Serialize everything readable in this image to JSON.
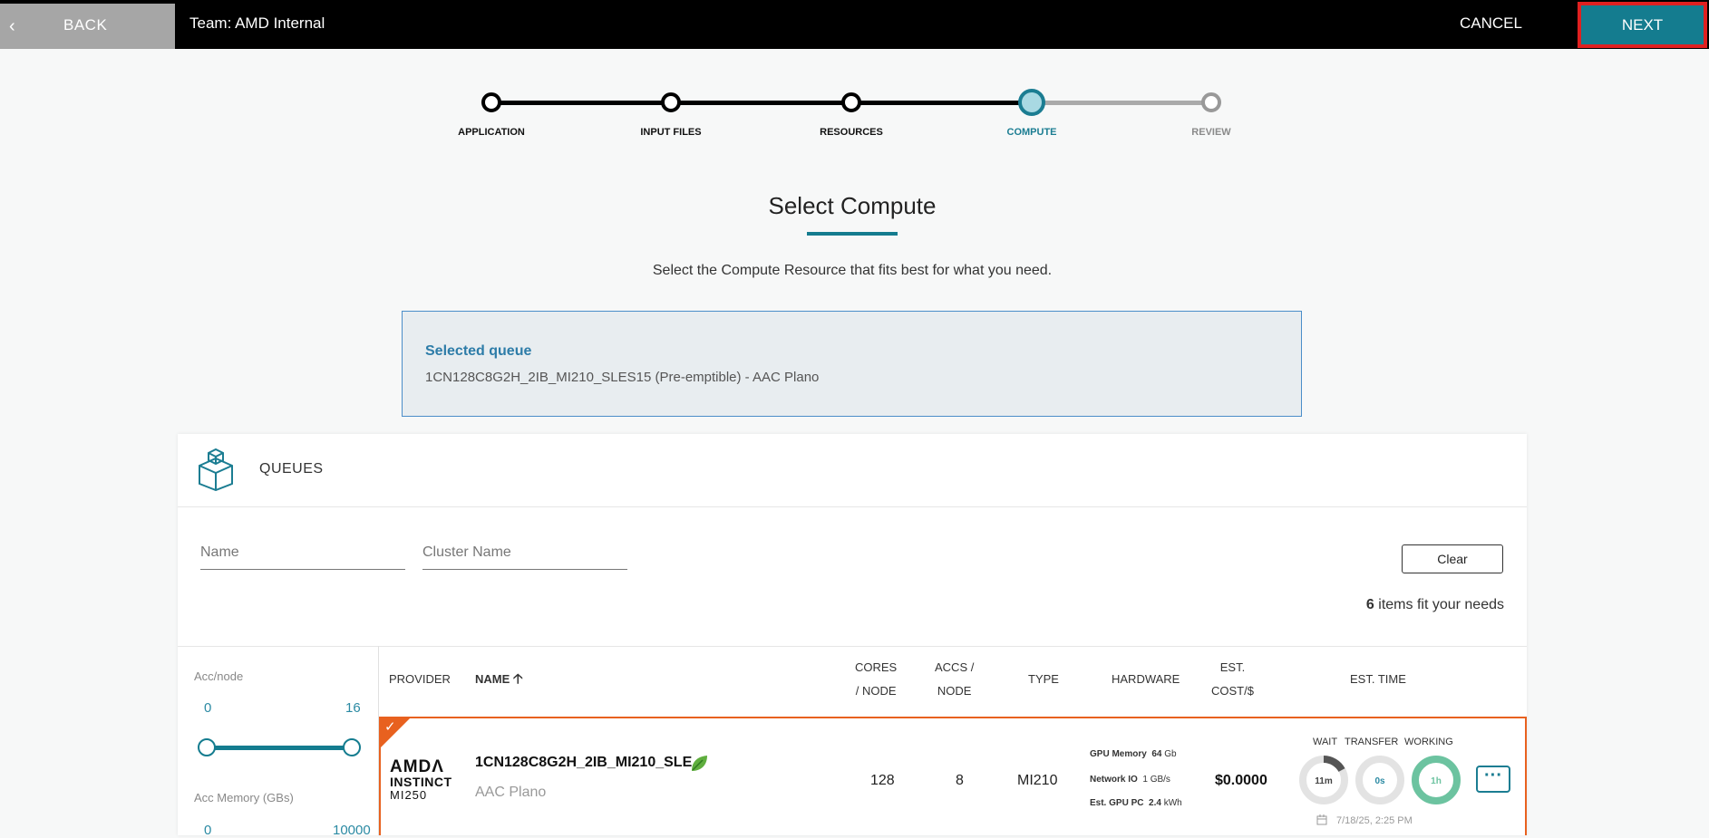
{
  "topbar": {
    "back_icon": "chevron-left-icon",
    "back_label": "BACK",
    "team": "Team: AMD Internal",
    "cancel_label": "CANCEL",
    "next_label": "NEXT"
  },
  "steps": [
    {
      "label": "APPLICATION",
      "state": "done"
    },
    {
      "label": "INPUT FILES",
      "state": "done"
    },
    {
      "label": "RESOURCES",
      "state": "done"
    },
    {
      "label": "COMPUTE",
      "state": "current"
    },
    {
      "label": "REVIEW",
      "state": "future"
    }
  ],
  "page": {
    "title": "Select Compute",
    "subtitle": "Select the Compute Resource that fits best for what you need."
  },
  "selected_queue": {
    "heading": "Selected queue",
    "value": "1CN128C8G2H_2IB_MI210_SLES15 (Pre-emptible) - AAC Plano"
  },
  "queues": {
    "title": "QUEUES",
    "icon": "cube-icon",
    "filters": {
      "name_placeholder": "Name",
      "cluster_placeholder": "Cluster Name"
    },
    "clear_label": "Clear",
    "count": "6",
    "count_suffix": " items fit your needs",
    "side_filters": {
      "acc_node_label": "Acc/node",
      "acc_node_min": "0",
      "acc_node_max": "16",
      "acc_memory_label": "Acc Memory (GBs)",
      "acc_memory_min": "0",
      "acc_memory_max": "10000"
    },
    "columns": {
      "provider": "PROVIDER",
      "name": "NAME",
      "cores_1": "CORES",
      "cores_2": "/ NODE",
      "accs_1": "ACCS /",
      "accs_2": "NODE",
      "type": "TYPE",
      "hardware": "HARDWARE",
      "cost_1": "EST.",
      "cost_2": "COST/$",
      "time": "EST. TIME"
    },
    "row": {
      "logo_line1": "AMDΛ",
      "logo_line2": "INSTINCT",
      "logo_line3": "MI250",
      "name": "1CN128C8G2H_2IB_MI210_SLE...",
      "cluster": "AAC Plano",
      "cores": "128",
      "accs": "8",
      "type": "MI210",
      "hw_gpu_memory_label": "GPU Memory",
      "hw_gpu_memory_value": "64",
      "hw_gpu_memory_unit": "Gb",
      "hw_network_label": "Network IO",
      "hw_network_value": "1 GB/s",
      "hw_gpu_pc_label": "Est. GPU PC",
      "hw_gpu_pc_value": "2.4",
      "hw_gpu_pc_unit": "kWh",
      "cost": "$0.0000",
      "wait_label": "WAIT",
      "transfer_label": "TRANSFER",
      "working_label": "WORKING",
      "wait_value": "11m",
      "transfer_value": "0s",
      "working_value": "1h",
      "date": "7/18/25, 2:25 PM"
    }
  },
  "colors": {
    "accent": "#147c8f",
    "selected_border": "#e8611f",
    "highlight": "#e02020",
    "working_ring": "#6cc3a0"
  }
}
